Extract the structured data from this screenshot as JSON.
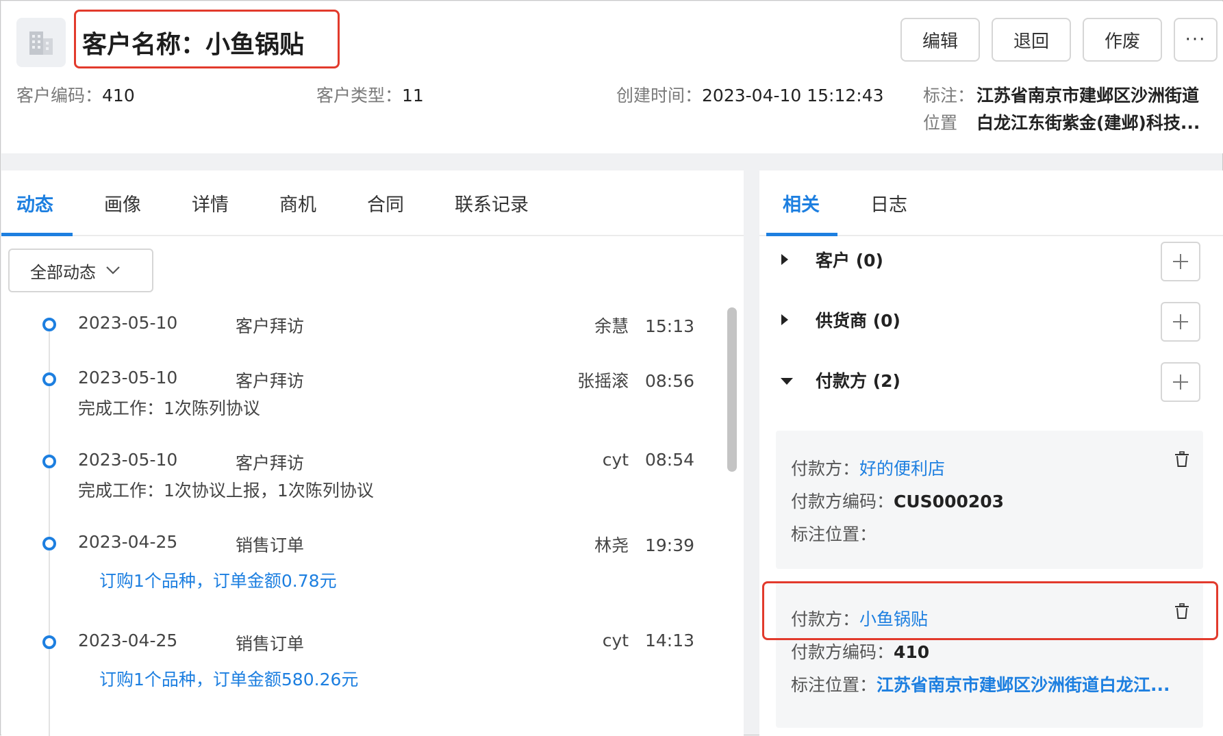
{
  "header": {
    "building_icon": "building-icon",
    "title": "客户名称：小鱼锅贴",
    "buttons": {
      "edit": "编辑",
      "return": "退回",
      "void": "作废",
      "more": "···"
    },
    "meta": {
      "code_label": "客户编码：",
      "code_value": "410",
      "type_label": "客户类型：",
      "type_value": "11",
      "created_label": "创建时间：",
      "created_value": "2023-04-10 15:12:43",
      "location_label_1": "标注：",
      "location_label_2": "位置",
      "location_line1": "江苏省南京市建邺区沙洲街道",
      "location_line2": "白龙江东街紫金(建邺)科技..."
    }
  },
  "left_tabs": [
    "动态",
    "画像",
    "详情",
    "商机",
    "合同",
    "联系记录"
  ],
  "filter": {
    "label": "全部动态",
    "icon": "chevron-down-icon"
  },
  "timeline": [
    {
      "date": "2023-05-10",
      "type": "客户拜访",
      "user": "余慧",
      "time": "15:13",
      "desc": ""
    },
    {
      "date": "2023-05-10",
      "type": "客户拜访",
      "user": "张摇滚",
      "time": "08:56",
      "desc": "完成工作：1次陈列协议"
    },
    {
      "date": "2023-05-10",
      "type": "客户拜访",
      "user": "cyt",
      "time": "08:54",
      "desc": "完成工作：1次协议上报，1次陈列协议"
    },
    {
      "date": "2023-04-25",
      "type": "销售订单",
      "user": "林尧",
      "time": "19:39",
      "link": "订购1个品种，订单金额0.78元"
    },
    {
      "date": "2023-04-25",
      "type": "销售订单",
      "user": "cyt",
      "time": "14:13",
      "link": "订购1个品种，订单金额580.26元"
    }
  ],
  "right_tabs": [
    "相关",
    "日志"
  ],
  "sections": [
    {
      "label": "客户 (0)",
      "expanded": false
    },
    {
      "label": "供货商 (0)",
      "expanded": false
    },
    {
      "label": "付款方 (2)",
      "expanded": true
    }
  ],
  "payers": [
    {
      "payer_label": "付款方：",
      "payer_name": "好的便利店",
      "code_label": "付款方编码：",
      "code": "CUS000203",
      "loc_label": "标注位置：",
      "loc": ""
    },
    {
      "payer_label": "付款方：",
      "payer_name": "小鱼锅贴",
      "code_label": "付款方编码：",
      "code": "410",
      "loc_label": "标注位置：",
      "loc": "江苏省南京市建邺区沙洲街道白龙江..."
    }
  ],
  "colors": {
    "accent": "#1d7fe0",
    "highlight": "#e23a2c"
  }
}
